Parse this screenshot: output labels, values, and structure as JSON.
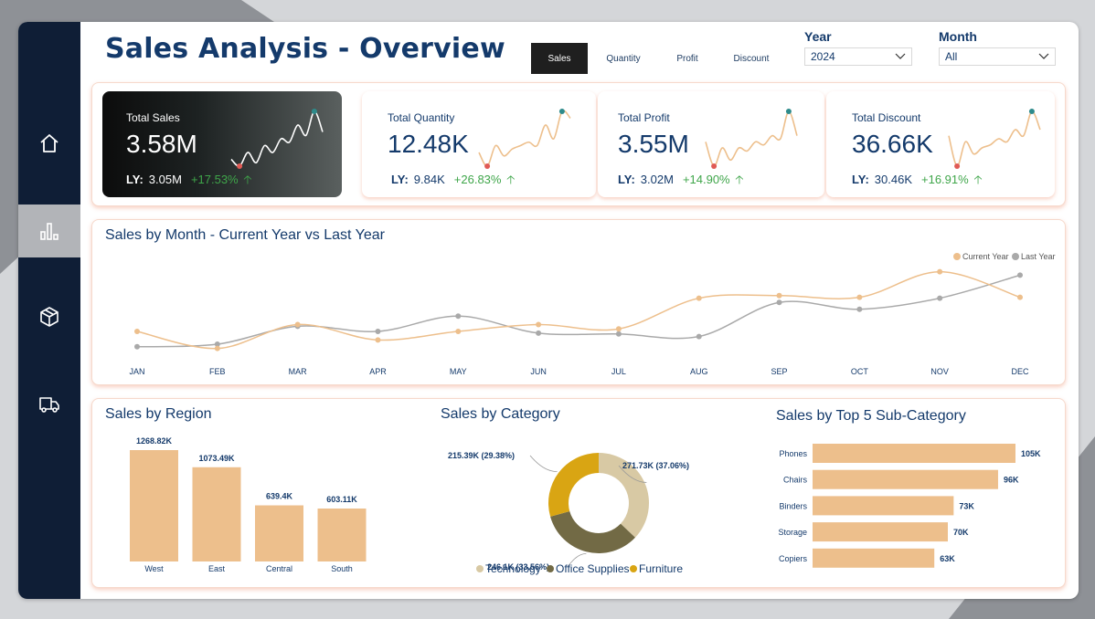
{
  "title": "Sales Analysis - Overview",
  "tabs": [
    "Sales",
    "Quantity",
    "Profit",
    "Discount"
  ],
  "filters": {
    "year_label": "Year",
    "year_value": "2024",
    "month_label": "Month",
    "month_value": "All"
  },
  "nav_icons": [
    "home-icon",
    "bar-chart-icon",
    "box-icon",
    "truck-icon"
  ],
  "kpis": [
    {
      "label": "Total Sales",
      "value": "3.58M",
      "ly_label": "LY:",
      "ly_value": "3.05M",
      "change": "+17.53%",
      "arrow": "🡡"
    },
    {
      "label": "Total Quantity",
      "value": "12.48K",
      "ly_label": "LY:",
      "ly_value": "9.84K",
      "change": "+26.83%",
      "arrow": "🡡"
    },
    {
      "label": "Total Profit",
      "value": "3.55M",
      "ly_label": "LY:",
      "ly_value": "3.02M",
      "change": "+14.90%",
      "arrow": "🡡"
    },
    {
      "label": "Total Discount",
      "value": "36.66K",
      "ly_label": "LY:",
      "ly_value": "30.46K",
      "change": "+16.91%",
      "arrow": "🡡"
    }
  ],
  "colors": {
    "accent": "#edbf8c",
    "navy": "#143a6b",
    "last_year": "#a9a9a9",
    "green": "#3fa64a",
    "low_marker": "#e05a55",
    "high_marker": "#2e8b8b",
    "technology": "#d8c9a4",
    "office": "#726a45",
    "furniture": "#d9a513"
  },
  "chart_data": [
    {
      "type": "line",
      "title": "Sales by Month - Current Year vs Last Year",
      "categories": [
        "JAN",
        "FEB",
        "MAR",
        "APR",
        "MAY",
        "JUN",
        "JUL",
        "AUG",
        "SEP",
        "OCT",
        "NOV",
        "DEC"
      ],
      "series": [
        {
          "name": "Current Year",
          "values": [
            3,
            1,
            3.8,
            2,
            3,
            3.8,
            3.3,
            6.9,
            7.2,
            7,
            10,
            7
          ]
        },
        {
          "name": "Last Year",
          "values": [
            1.2,
            1.5,
            3.6,
            3,
            4.8,
            2.8,
            2.7,
            2.4,
            6.4,
            5.6,
            6.9,
            9.6
          ]
        }
      ],
      "ylim": [
        0,
        12
      ],
      "legend": "top-right"
    },
    {
      "type": "bar",
      "title": "Sales by Region",
      "categories": [
        "West",
        "East",
        "Central",
        "South"
      ],
      "values": [
        1268.82,
        1073.49,
        639.4,
        603.11
      ],
      "labels": [
        "1268.82K",
        "1073.49K",
        "639.4K",
        "603.11K"
      ]
    },
    {
      "type": "pie",
      "title": "Sales by Category",
      "categories": [
        "Technology",
        "Office Supplies",
        "Furniture"
      ],
      "values": [
        271.73,
        246.1,
        215.39
      ],
      "labels": [
        "271.73K (37.06%)",
        "246.1K (33.56%)",
        "215.39K (29.38%)"
      ]
    },
    {
      "type": "bar",
      "title": "Sales by Top 5 Sub-Category",
      "categories": [
        "Phones",
        "Chairs",
        "Binders",
        "Storage",
        "Copiers"
      ],
      "values": [
        105,
        96,
        73,
        70,
        63
      ],
      "labels": [
        "105K",
        "96K",
        "73K",
        "70K",
        "63K"
      ]
    }
  ],
  "sparklines": [
    [
      3,
      2,
      4,
      2.5,
      5,
      4,
      6,
      5.5,
      8,
      6.5,
      10,
      7
    ],
    [
      4,
      2,
      5,
      3.5,
      4.5,
      5,
      5.5,
      5,
      8,
      6,
      10,
      9
    ],
    [
      5,
      1,
      4,
      2,
      4,
      3.5,
      5,
      4.5,
      6,
      5.5,
      10,
      6
    ],
    [
      6,
      1,
      5,
      3,
      4,
      4.5,
      5.5,
      5,
      7,
      6,
      10,
      7
    ]
  ]
}
